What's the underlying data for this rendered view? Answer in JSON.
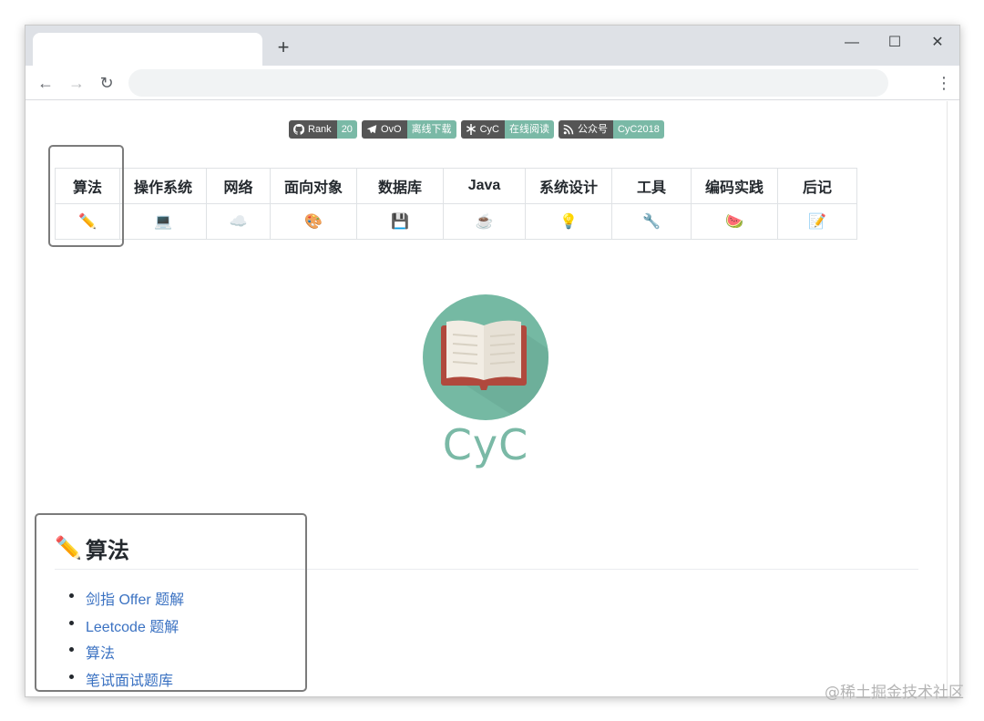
{
  "browser": {
    "new_tab_glyph": "+",
    "back_glyph": "←",
    "forward_glyph": "→",
    "reload_glyph": "↻",
    "menu_glyph": "⋮",
    "minimize_glyph": "—",
    "maximize_glyph": "☐",
    "close_glyph": "✕"
  },
  "badges": [
    {
      "icon": "github-icon",
      "label": "Rank",
      "value": "20"
    },
    {
      "icon": "telegram-icon",
      "label": "OvO",
      "value": "离线下载"
    },
    {
      "icon": "asterisk-icon",
      "label": "CyC",
      "value": "在线阅读"
    },
    {
      "icon": "rss-icon",
      "label": "公众号",
      "value": "CyC2018"
    }
  ],
  "nav_table": {
    "headers": [
      "算法",
      "操作系统",
      "网络",
      "面向对象",
      "数据库",
      "Java",
      "系统设计",
      "工具",
      "编码实践",
      "后记"
    ],
    "icons": [
      "✏️",
      "💻",
      "☁️",
      "🎨",
      "💾",
      "☕️",
      "💡",
      "🔧",
      "🍉",
      "📝"
    ]
  },
  "logo": {
    "text": "CyC",
    "color": "#75b9a3"
  },
  "section": {
    "icon": "✏️",
    "title": "算法",
    "links": [
      "剑指 Offer 题解",
      "Leetcode 题解",
      "算法",
      "笔试面试题库"
    ]
  },
  "watermark": "@稀土掘金技术社区"
}
